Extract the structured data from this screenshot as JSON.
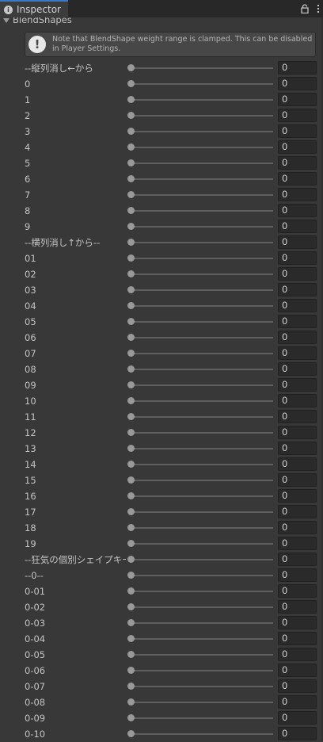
{
  "tab": {
    "title": "Inspector",
    "icon": "info-icon"
  },
  "section": {
    "title": "BlendShapes"
  },
  "helpbox": {
    "line1": "Note that BlendShape weight range is clamped. This can be disabled",
    "line2": "in Player Settings."
  },
  "rows": [
    {
      "label": "--縦列消し←から",
      "value": "0"
    },
    {
      "label": "0",
      "value": "0"
    },
    {
      "label": "1",
      "value": "0"
    },
    {
      "label": "2",
      "value": "0"
    },
    {
      "label": "3",
      "value": "0"
    },
    {
      "label": "4",
      "value": "0"
    },
    {
      "label": "5",
      "value": "0"
    },
    {
      "label": "6",
      "value": "0"
    },
    {
      "label": "7",
      "value": "0"
    },
    {
      "label": "8",
      "value": "0"
    },
    {
      "label": "9",
      "value": "0"
    },
    {
      "label": "--横列消し↑から--",
      "value": "0"
    },
    {
      "label": "01",
      "value": "0"
    },
    {
      "label": "02",
      "value": "0"
    },
    {
      "label": "03",
      "value": "0"
    },
    {
      "label": "04",
      "value": "0"
    },
    {
      "label": "05",
      "value": "0"
    },
    {
      "label": "06",
      "value": "0"
    },
    {
      "label": "07",
      "value": "0"
    },
    {
      "label": "08",
      "value": "0"
    },
    {
      "label": "09",
      "value": "0"
    },
    {
      "label": "10",
      "value": "0"
    },
    {
      "label": "11",
      "value": "0"
    },
    {
      "label": "12",
      "value": "0"
    },
    {
      "label": "13",
      "value": "0"
    },
    {
      "label": "14",
      "value": "0"
    },
    {
      "label": "15",
      "value": "0"
    },
    {
      "label": "16",
      "value": "0"
    },
    {
      "label": "17",
      "value": "0"
    },
    {
      "label": "18",
      "value": "0"
    },
    {
      "label": "19",
      "value": "0"
    },
    {
      "label": "--狂気の個別シェイプキー--",
      "value": "0"
    },
    {
      "label": "--0--",
      "value": "0"
    },
    {
      "label": "0-01",
      "value": "0"
    },
    {
      "label": "0-02",
      "value": "0"
    },
    {
      "label": "0-03",
      "value": "0"
    },
    {
      "label": "0-04",
      "value": "0"
    },
    {
      "label": "0-05",
      "value": "0"
    },
    {
      "label": "0-06",
      "value": "0"
    },
    {
      "label": "0-07",
      "value": "0"
    },
    {
      "label": "0-08",
      "value": "0"
    },
    {
      "label": "0-09",
      "value": "0"
    },
    {
      "label": "0-10",
      "value": "0"
    }
  ]
}
